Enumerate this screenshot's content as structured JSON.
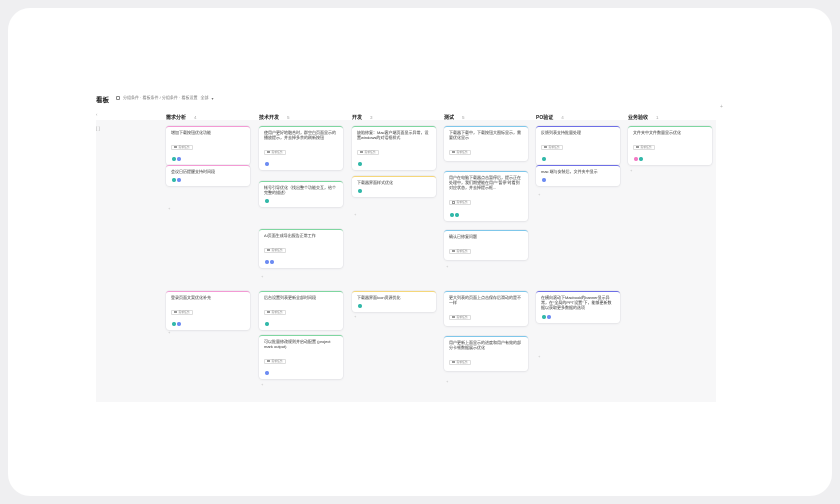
{
  "header": {
    "title": "看板",
    "filter_text": "分组条件 · 看板条件 / 分组条件 · 看板设置",
    "filter_dropdown": "全部",
    "add_column": "+"
  },
  "lane": {
    "collapse": "‹",
    "bracket": "[ ]"
  },
  "colors": {
    "pink": "#f39ad4",
    "green": "#7fd6a0",
    "yellow": "#f5d77a",
    "blue": "#7fc7ea",
    "purple": "#6e6fe6",
    "teal": "#2bbfa6",
    "avatar_blue": "#6d8cf2",
    "avatar_teal": "#32b8a9",
    "avatar_pink": "#f27ac4"
  },
  "columns": [
    {
      "name": "需求分析",
      "count": "4"
    },
    {
      "name": "技术开发",
      "count": "5"
    },
    {
      "name": "开发",
      "count": "3"
    },
    {
      "name": "测试",
      "count": "5"
    },
    {
      "name": "PO验证",
      "count": "4"
    },
    {
      "name": "业务验收",
      "count": "1"
    }
  ],
  "tag_label": "需求任务",
  "cards": [
    {
      "text": "增加下载按钮优化功能"
    },
    {
      "text": "会议日历提醒支持时间段"
    },
    {
      "text": "登录页面文案优化补充"
    },
    {
      "text": "使用户更好地融合时，群空白页面显示的播放提示，并去掉多余的刷新按钮"
    },
    {
      "text": "帐号引导优化（找出整个功能交互，给个完整的描述）"
    },
    {
      "text": "AI页面生成导出报告正常工作"
    },
    {
      "text": "后台设置列表更新全部时间段"
    },
    {
      "text": "可以批量修改规则并启动配置 (project mark output)"
    },
    {
      "text": "缺陷修复：Mac客户端页面显示异常，设置windows的对话框样式"
    },
    {
      "text": "下载器界面样式优化"
    },
    {
      "text": "下载器界面Icon资源优化"
    },
    {
      "text": "下载器下载中，下载按钮大图标显示，需要优化显示"
    },
    {
      "text": "用户在电脑下载器点击暂停后，提示正在处理中，我们期望能在用户“暂停”时看到对应状态，并去掉提示框..."
    },
    {
      "text": "确认已修复问题"
    },
    {
      "text": "更大列表的页面上点击保存后滑动的是不一样"
    },
    {
      "text": "用户更新上面显示的进度和用户有效的部分卡顿数据展示优化"
    },
    {
      "text": "反馈列表支持批量处理"
    },
    {
      "text": "mac 端与安装后，文件夹中显示"
    },
    {
      "text": "在横向滚动下Macbook的banner显示异常，在“全局的PPT设置”下，能够更新数据以获取更多数据的选项"
    },
    {
      "text": "文件夹中文件数量显示优化"
    }
  ]
}
